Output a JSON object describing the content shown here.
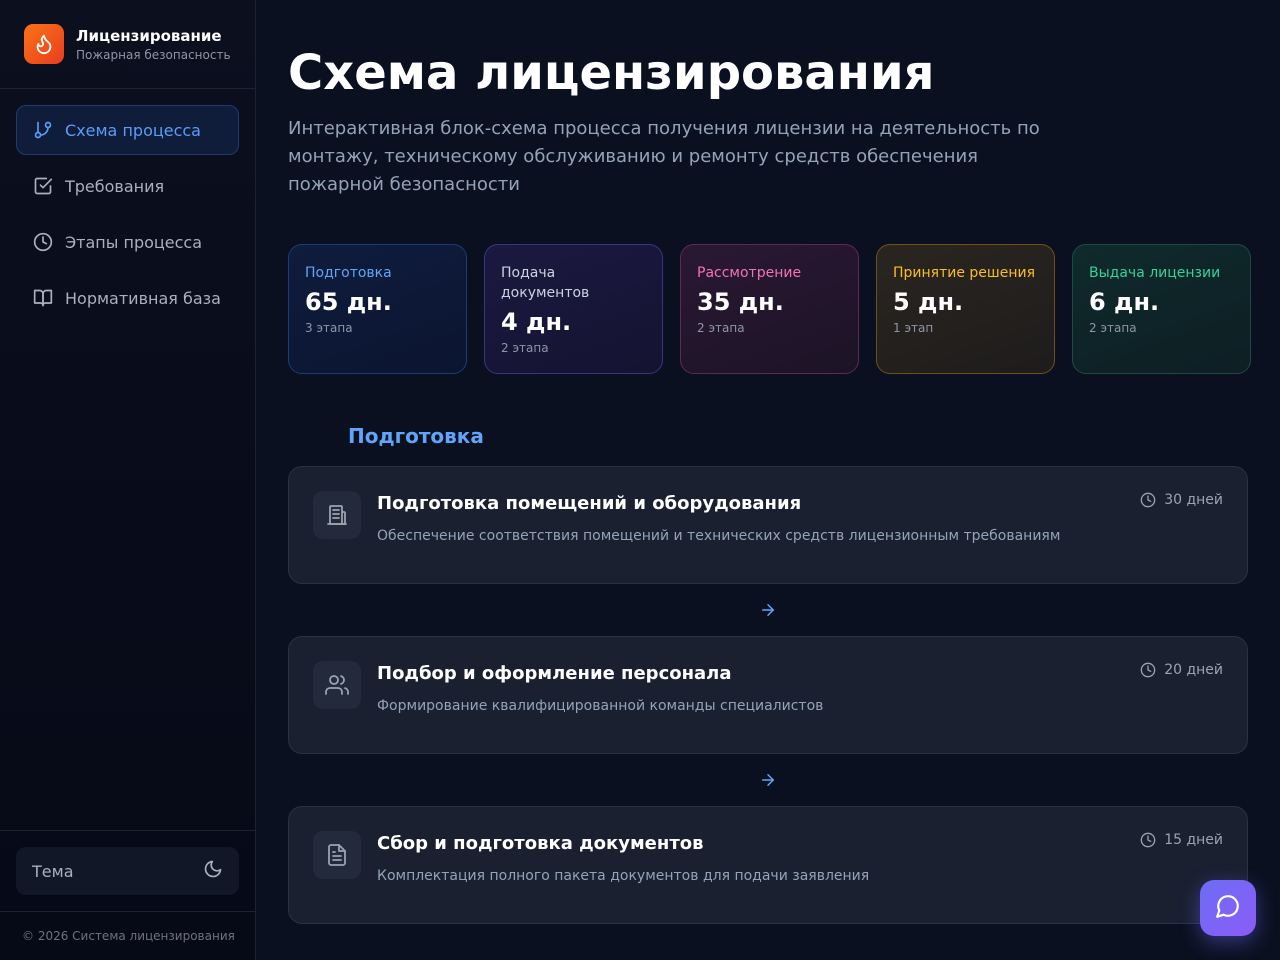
{
  "brand": {
    "title": "Лицензирование",
    "subtitle": "Пожарная безопасность",
    "logo_icon": "flame-icon"
  },
  "nav": {
    "items": [
      {
        "label": "Схема процесса",
        "icon": "git-branch-icon",
        "active": true
      },
      {
        "label": "Требования",
        "icon": "check-square-icon",
        "active": false
      },
      {
        "label": "Этапы процесса",
        "icon": "clock-icon",
        "active": false
      },
      {
        "label": "Нормативная база",
        "icon": "book-open-icon",
        "active": false
      }
    ]
  },
  "theme": {
    "label": "Тема",
    "icon": "moon-icon"
  },
  "footer": {
    "copyright": "© 2026 Система лицензирования"
  },
  "page": {
    "title": "Схема лицензирования",
    "description": "Интерактивная блок-схема процесса получения лицензии на деятельность по монтажу, техническому обслуживанию и ремонту средств обеспечения пожарной безопасности"
  },
  "stats": [
    {
      "label": "Подготовка",
      "value": "65 дн.",
      "sub": "3 этапа",
      "color": "#60a5fa"
    },
    {
      "label": "Подача документов",
      "value": "4 дн.",
      "sub": "2 этапа",
      "color": "#cbd2e0"
    },
    {
      "label": "Рассмотрение",
      "value": "35 дн.",
      "sub": "2 этапа",
      "color": "#f472b6"
    },
    {
      "label": "Принятие решения",
      "value": "5 дн.",
      "sub": "1 этап",
      "color": "#fbbf24"
    },
    {
      "label": "Выдача лицензии",
      "value": "6 дн.",
      "sub": "2 этапа",
      "color": "#34d399"
    }
  ],
  "section": {
    "title": "Подготовка"
  },
  "steps": [
    {
      "title": "Подготовка помещений и оборудования",
      "description": "Обеспечение соответствия помещений и технических средств лицензионным требованиям",
      "duration": "30 дней",
      "icon": "building-icon"
    },
    {
      "title": "Подбор и оформление персонала",
      "description": "Формирование квалифицированной команды специалистов",
      "duration": "20 дней",
      "icon": "users-icon"
    },
    {
      "title": "Сбор и подготовка документов",
      "description": "Комплектация полного пакета документов для подачи заявления",
      "duration": "15 дней",
      "icon": "file-text-icon"
    }
  ],
  "chat": {
    "icon": "chat-bubble-icon"
  }
}
